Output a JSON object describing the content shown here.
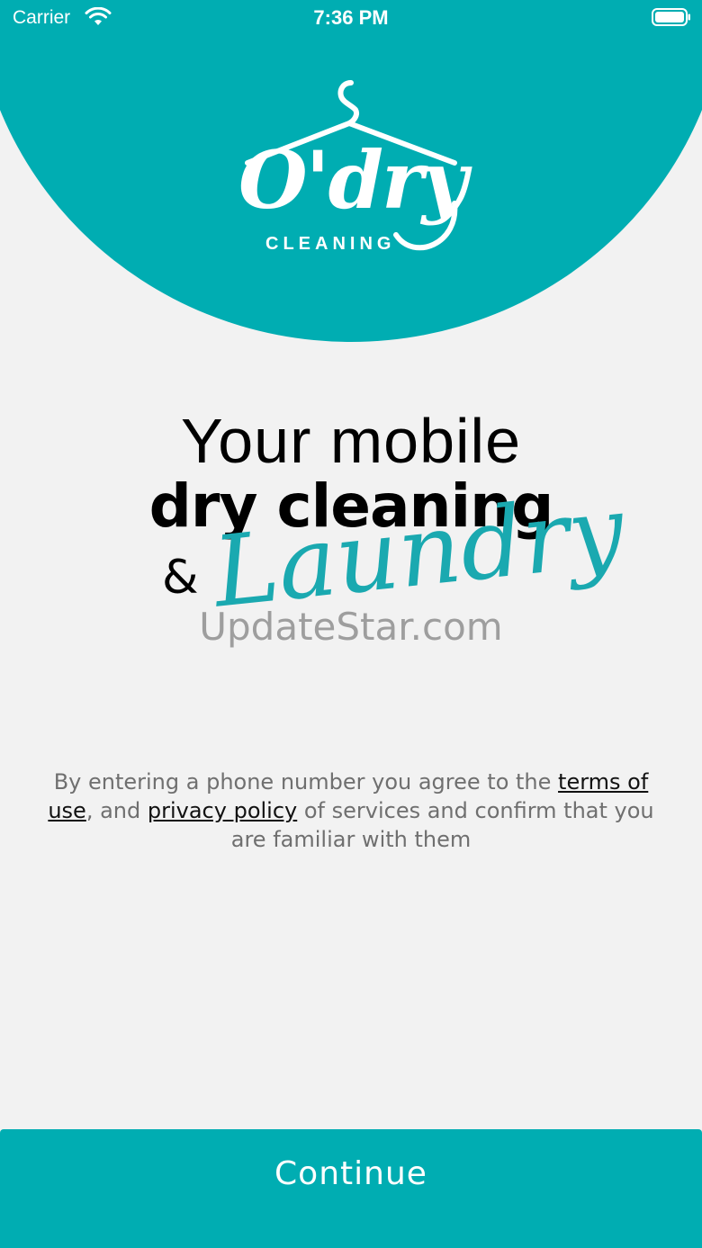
{
  "status_bar": {
    "carrier": "Carrier",
    "time": "7:36 PM",
    "wifi_icon": "wifi-icon",
    "battery_icon": "battery-icon"
  },
  "logo": {
    "wordmark": "O'dry",
    "subtitle": "CLEANING",
    "icon": "hanger-icon"
  },
  "headline": {
    "line1": "Your mobile",
    "line2": "dry cleaning",
    "ampersand": "&",
    "script": "Laundry"
  },
  "watermark": "UpdateStar.com",
  "legal": {
    "prefix": "By entering a phone number you agree to the ",
    "terms_link": "terms of use",
    "middle": ", and ",
    "privacy_link": "privacy policy",
    "suffix": " of services and confirm that you are familiar with them"
  },
  "continue_label": "Continue",
  "colors": {
    "accent": "#00adb2",
    "background": "#f2f2f2",
    "script": "#1aa9b0"
  }
}
